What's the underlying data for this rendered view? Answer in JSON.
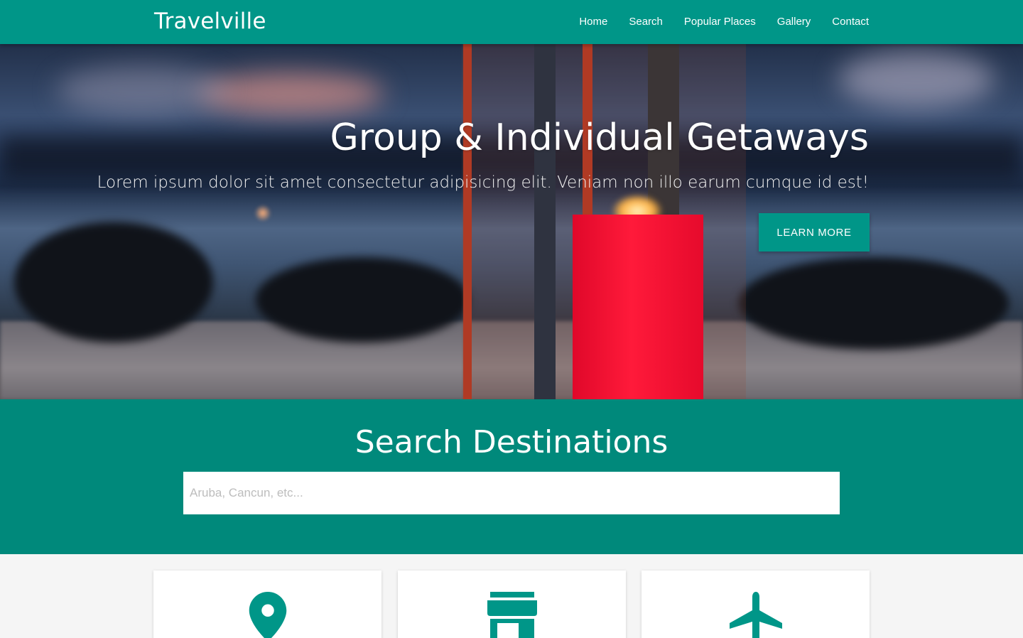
{
  "nav": {
    "brand": "Travelville",
    "items": [
      {
        "label": "Home"
      },
      {
        "label": "Search"
      },
      {
        "label": "Popular Places"
      },
      {
        "label": "Gallery"
      },
      {
        "label": "Contact"
      }
    ]
  },
  "hero": {
    "title": "Group & Individual Getaways",
    "subtitle": "Lorem ipsum dolor sit amet consectetur adipisicing elit. Veniam non illo earum cumque id est!",
    "button_label": "LEARN MORE"
  },
  "search": {
    "title": "Search Destinations",
    "placeholder": "Aruba, Cancun, etc..."
  },
  "cards": [
    {
      "icon": "map-marker-icon"
    },
    {
      "icon": "store-icon"
    },
    {
      "icon": "airplane-icon"
    }
  ],
  "colors": {
    "primary": "#009688",
    "search_bg": "#00897b",
    "page_bg": "#f5f5f5"
  }
}
